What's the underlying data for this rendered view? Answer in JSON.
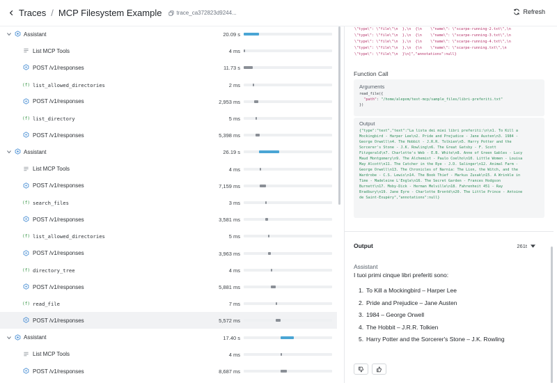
{
  "header": {
    "back_icon": "chevron-left-icon",
    "breadcrumb": "Traces",
    "separator": "/",
    "title": "MCP Filesystem Example",
    "trace_id": "trace_ca372823d9244...",
    "refresh_label": "Refresh"
  },
  "spans": [
    {
      "type": "agent",
      "label": "Assistant",
      "duration": "20.09 s",
      "bar_start": 0.0,
      "bar_width": 0.17,
      "color": "#4aa5d4",
      "mono": false
    },
    {
      "type": "tool-list",
      "label": "List MCP Tools",
      "duration": "4 ms",
      "bar_start": 0.0,
      "bar_width": 0.015,
      "color": "#8a8f96",
      "mono": false
    },
    {
      "type": "request",
      "label": "POST /v1/responses",
      "duration": "11.73 s",
      "bar_start": 0.0,
      "bar_width": 0.1,
      "color": "#8a8f96",
      "mono": false
    },
    {
      "type": "function",
      "label": "list_allowed_directories",
      "duration": "2 ms",
      "bar_start": 0.105,
      "bar_width": 0.015,
      "color": "#8a8f96",
      "mono": true
    },
    {
      "type": "request",
      "label": "POST /v1/responses",
      "duration": "2,953 ms",
      "bar_start": 0.115,
      "bar_width": 0.05,
      "color": "#8a8f96",
      "mono": false
    },
    {
      "type": "function",
      "label": "list_directory",
      "duration": "5 ms",
      "bar_start": 0.135,
      "bar_width": 0.015,
      "color": "#8a8f96",
      "mono": true
    },
    {
      "type": "request",
      "label": "POST /v1/responses",
      "duration": "5,398 ms",
      "bar_start": 0.135,
      "bar_width": 0.05,
      "color": "#8a8f96",
      "mono": false
    },
    {
      "type": "agent",
      "label": "Assistant",
      "duration": "26.19 s",
      "bar_start": 0.175,
      "bar_width": 0.23,
      "color": "#4aa5d4",
      "mono": false
    },
    {
      "type": "tool-list",
      "label": "List MCP Tools",
      "duration": "4 ms",
      "bar_start": 0.185,
      "bar_width": 0.015,
      "color": "#8a8f96",
      "mono": false
    },
    {
      "type": "request",
      "label": "POST /v1/responses",
      "duration": "7,159 ms",
      "bar_start": 0.185,
      "bar_width": 0.065,
      "color": "#8a8f96",
      "mono": false
    },
    {
      "type": "function",
      "label": "search_files",
      "duration": "3 ms",
      "bar_start": 0.245,
      "bar_width": 0.015,
      "color": "#8a8f96",
      "mono": true
    },
    {
      "type": "request",
      "label": "POST /v1/responses",
      "duration": "3,581 ms",
      "bar_start": 0.245,
      "bar_width": 0.03,
      "color": "#8a8f96",
      "mono": false
    },
    {
      "type": "function",
      "label": "list_allowed_directories",
      "duration": "5 ms",
      "bar_start": 0.275,
      "bar_width": 0.015,
      "color": "#8a8f96",
      "mono": true
    },
    {
      "type": "request",
      "label": "POST /v1/responses",
      "duration": "3,963 ms",
      "bar_start": 0.275,
      "bar_width": 0.035,
      "color": "#8a8f96",
      "mono": false
    },
    {
      "type": "function",
      "label": "directory_tree",
      "duration": "4 ms",
      "bar_start": 0.31,
      "bar_width": 0.015,
      "color": "#8a8f96",
      "mono": true
    },
    {
      "type": "request",
      "label": "POST /v1/responses",
      "duration": "5,881 ms",
      "bar_start": 0.31,
      "bar_width": 0.055,
      "color": "#8a8f96",
      "mono": false
    },
    {
      "type": "function",
      "label": "read_file",
      "duration": "7 ms",
      "bar_start": 0.365,
      "bar_width": 0.015,
      "color": "#8a8f96",
      "mono": true
    },
    {
      "type": "request",
      "label": "POST /v1/responses",
      "duration": "5,572 ms",
      "bar_start": 0.365,
      "bar_width": 0.05,
      "color": "#8a8f96",
      "mono": false
    },
    {
      "type": "agent",
      "label": "Assistant",
      "duration": "17.40 s",
      "bar_start": 0.415,
      "bar_width": 0.15,
      "color": "#4aa5d4",
      "mono": false
    },
    {
      "type": "tool-list",
      "label": "List MCP Tools",
      "duration": "4 ms",
      "bar_start": 0.42,
      "bar_width": 0.015,
      "color": "#8a8f96",
      "mono": false
    },
    {
      "type": "request",
      "label": "POST /v1/responses",
      "duration": "8,687 ms",
      "bar_start": 0.42,
      "bar_width": 0.07,
      "color": "#8a8f96",
      "mono": false
    }
  ],
  "selected_span": 17,
  "detail": {
    "top_code": [
      "\\\"type\\\": \\\"file\\\"\\n  },\\n  {\\n    \\\"name\\\": \\\"scarpe-running-2.txt\\\",\\n",
      "\\\"type\\\": \\\"file\\\"\\n  },\\n  {\\n    \\\"name\\\": \\\"scarpe-running-3.txt\\\",\\n",
      "\\\"type\\\": \\\"file\\\"\\n  },\\n  {\\n    \\\"name\\\": \\\"scarpe-running-4.txt\\\",\\n",
      "\\\"type\\\": \\\"file\\\"\\n  },\\n  {\\n    \\\"name\\\": \\\"scarpe-running.txt\\\",\\n",
      "\\\"type\\\": \\\"file\\\"\\n  }\\n]\",\"annotations\":null}"
    ],
    "function_call_title": "Function Call",
    "arguments_title": "Arguments",
    "arguments_code": [
      "read_file({",
      "  \"path\": \"/home/alepom/test-mcp/sample_files/libri-preferiti.txt\"",
      "})"
    ],
    "output_box_title": "Output",
    "output_code": [
      "{\"type\":\"text\",\"text\":\"La lista dei miei libri preferiti:\\n\\n1. To Kill a",
      "Mockingbird - Harper Lee\\n2. Pride and Prejudice - Jane Austen\\n3. 1984 -",
      "George Orwell\\n4. The Hobbit - J.R.R. Tolkien\\n5. Harry Potter and the",
      "Sorcerer's Stone - J.K. Rowling\\n6. The Great Gatsby - F. Scott",
      "Fitzgerald\\n7. Charlotte's Web - E.B. White\\n8. Anne of Green Gables - Lucy",
      "Maud Montgomery\\n9. The Alchemist - Paulo Coelho\\n10. Little Women - Louisa",
      "May Alcott\\n11. The Catcher in the Rye - J.D. Salinger\\n12. Animal Farm -",
      "George Orwell\\n13. The Chronicles of Narnia: The Lion, the Witch, and the",
      "Wardrobe - C.S. Lewis\\n14. The Book Thief - Markus Zusak\\n15. A Wrinkle in",
      "Time - Madeleine L'Engle\\n16. The Secret Garden - Frances Hodgson",
      "Burnett\\n17. Moby-Dick - Herman Melville\\n18. Fahrenheit 451 - Ray",
      "Bradbury\\n19. Jane Eyre - Charlotte Brontë\\n20. The Little Prince - Antoine",
      "de Saint-Exupéry\",\"annotations\":null}"
    ],
    "output_title": "Output",
    "tokens": "261t",
    "assistant_label": "Assistant",
    "intro": "I tuoi primi cinque libri preferiti sono:",
    "list": [
      {
        "num": "1.",
        "text": "To Kill a Mockingbird – Harper Lee"
      },
      {
        "num": "2.",
        "text": "Pride and Prejudice – Jane Austen"
      },
      {
        "num": "3.",
        "text": "1984 – George Orwell"
      },
      {
        "num": "4.",
        "text": "The Hobbit – J.R.R. Tolkien"
      },
      {
        "num": "5.",
        "text": "Harry Potter and the Sorcerer's Stone – J.K. Rowling"
      }
    ],
    "feedback_icons": [
      "thumbs-down-icon",
      "thumbs-up-icon"
    ]
  }
}
